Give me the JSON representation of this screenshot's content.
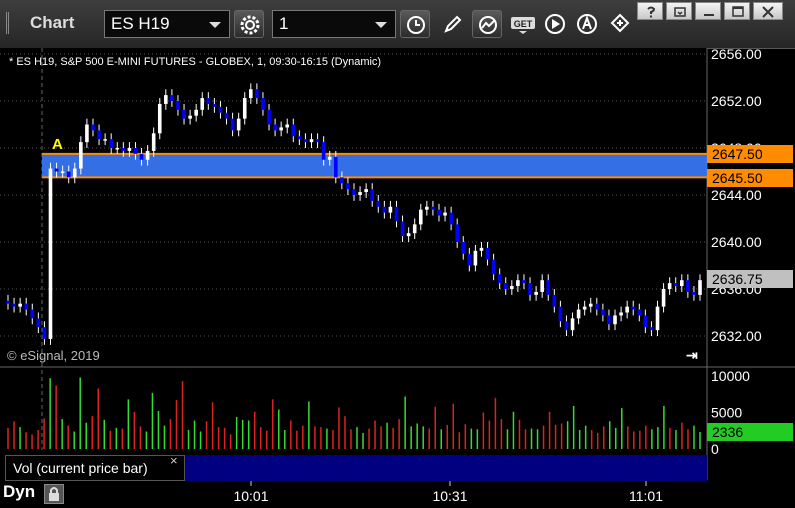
{
  "toolbar": {
    "app_title": "Chart",
    "symbol": "ES H19",
    "interval": "1"
  },
  "chart": {
    "series_title": "* ES H19, S&P 500 E-MINI FUTURES - GLOBEX, 1, 09:30-16:15 (Dynamic)",
    "watermark": "© eSignal, 2019",
    "marker_label": "A",
    "zone_upper": "2647.50",
    "zone_lower": "2645.50",
    "last_price": "2636.75",
    "price_ticks": [
      "2656.00",
      "2652.00",
      "2648.00",
      "2644.00",
      "2640.00",
      "2636.00",
      "2632.00"
    ],
    "time_ticks": [
      "10:01",
      "10:31",
      "11:01"
    ],
    "colors": {
      "up": "#ffffff",
      "down": "#0000ff",
      "zone": "#3a7bff",
      "zone_line": "#ff8c00",
      "last_box": "#c0c0c0"
    }
  },
  "volume": {
    "legend": "Vol (current price bar)",
    "close_glyph": "×",
    "ticks": [
      "10000",
      "5000",
      "0"
    ],
    "last_value": "2336",
    "colors": {
      "up": "#33dd33",
      "down": "#dd2222",
      "last_box": "#22cc22"
    }
  },
  "footer": {
    "mode": "Dyn"
  },
  "chart_data": [
    {
      "type": "candlestick",
      "title": "",
      "ylim": [
        2630,
        2656
      ],
      "y_ticks": [
        2656,
        2652,
        2648,
        2644,
        2640,
        2636,
        2632
      ],
      "x_ticks": [
        "10:01",
        "10:31",
        "11:01"
      ],
      "zone": [
        2645.5,
        2647.5
      ],
      "last": 2636.75,
      "closes": [
        2634.75,
        2634.5,
        2634.75,
        2634.25,
        2633.5,
        2632.75,
        2631.75,
        2646.25,
        2646,
        2646,
        2645.5,
        2646.25,
        2648.5,
        2650,
        2649.5,
        2648.75,
        2648.75,
        2648,
        2648,
        2647.75,
        2648,
        2647.5,
        2647,
        2647.75,
        2649.25,
        2651.75,
        2652.5,
        2652,
        2651.25,
        2650.5,
        2650.75,
        2651.25,
        2652.25,
        2651.75,
        2651.5,
        2651,
        2650.5,
        2649.5,
        2650.5,
        2652.25,
        2653,
        2652.25,
        2651.25,
        2650,
        2649.5,
        2649.75,
        2650,
        2649,
        2648.75,
        2648.5,
        2648.75,
        2648.5,
        2647,
        2647.25,
        2645.5,
        2645,
        2644.5,
        2644,
        2644.25,
        2644.5,
        2643.5,
        2643,
        2642.5,
        2643,
        2641.75,
        2640.5,
        2640.75,
        2641.5,
        2642.75,
        2643,
        2642.75,
        2642.25,
        2642.5,
        2641.5,
        2640,
        2639,
        2638,
        2639.25,
        2639.5,
        2638.5,
        2637.25,
        2636.5,
        2636,
        2636.25,
        2636.75,
        2636.5,
        2635.5,
        2635.75,
        2636.75,
        2635.5,
        2634.5,
        2633.25,
        2632.5,
        2633.5,
        2634.25,
        2634.5,
        2634.75,
        2634.25,
        2633.75,
        2633,
        2633.75,
        2634,
        2634.5,
        2634.25,
        2633.75,
        2632.75,
        2632.5,
        2634.5,
        2636,
        2636.5,
        2636.25,
        2636.75,
        2635.75,
        2635.5,
        2636.75
      ]
    },
    {
      "type": "bar",
      "title": "Vol (current price bar)",
      "ylim": [
        0,
        10000
      ],
      "y_ticks": [
        10000,
        5000,
        0
      ],
      "last": 2336,
      "values": [
        2900,
        3800,
        3000,
        2300,
        2000,
        2600,
        4200,
        9700,
        8700,
        4100,
        3200,
        2400,
        9800,
        3600,
        4500,
        8300,
        4000,
        2500,
        2900,
        2800,
        6800,
        5100,
        3100,
        2400,
        7700,
        5200,
        3200,
        4100,
        6700,
        9300,
        2600,
        3900,
        2400,
        3800,
        6400,
        3000,
        2900,
        2000,
        4400,
        4000,
        3900,
        5100,
        3000,
        2500,
        6800,
        5400,
        2600,
        3900,
        2500,
        3200,
        6500,
        3100,
        3000,
        2800,
        2600,
        5700,
        4500,
        2700,
        3000,
        2200,
        2800,
        3900,
        3100,
        3600,
        2900,
        4100,
        7200,
        3100,
        3500,
        3100,
        2800,
        5800,
        2700,
        3300,
        6200,
        2300,
        3400,
        2800,
        2700,
        5000,
        3900,
        7000,
        4100,
        2700,
        5100,
        4000,
        2700,
        2800,
        2700,
        3200,
        5100,
        3300,
        3500,
        3800,
        5900,
        2600,
        3200,
        2600,
        2200,
        3100,
        3800,
        2900,
        5600,
        3100,
        2400,
        2500,
        3200,
        2700,
        3000,
        5900,
        2900,
        2600,
        3600,
        2700,
        3200,
        2336
      ]
    }
  ]
}
